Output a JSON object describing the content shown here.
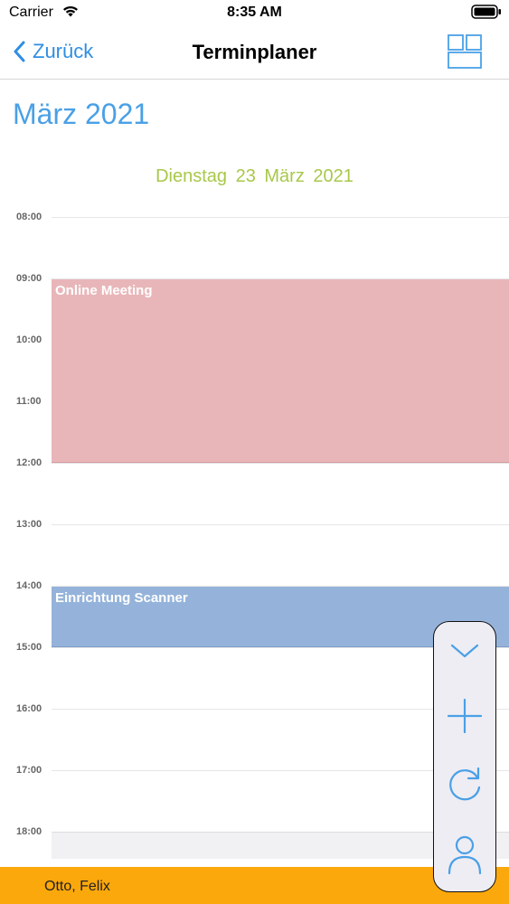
{
  "status_bar": {
    "carrier": "Carrier",
    "time": "8:35 AM"
  },
  "nav": {
    "back_label": "Zurück",
    "title": "Terminplaner",
    "layout_icon": "grid-layout-icon"
  },
  "calendar": {
    "month": "März 2021",
    "day": "Dienstag  23 März 2021",
    "hours": [
      "08:00",
      "09:00",
      "10:00",
      "11:00",
      "12:00",
      "13:00",
      "14:00",
      "15:00",
      "16:00",
      "17:00",
      "18:00"
    ],
    "events": [
      {
        "title": "Online Meeting",
        "start": "09:00",
        "end": "12:00",
        "color": "#e8b6b9"
      },
      {
        "title": "Einrichtung Scanner",
        "start": "14:00",
        "end": "15:00",
        "color": "#95b3da"
      }
    ]
  },
  "fab": {
    "icons": [
      "chevron-down-icon",
      "plus-icon",
      "refresh-icon",
      "person-icon"
    ]
  },
  "footer": {
    "user": "Otto, Felix",
    "color": "#fba80c"
  },
  "colors": {
    "accent": "#2f8ee3",
    "month": "#4aa0e6",
    "day": "#a8c84a"
  }
}
